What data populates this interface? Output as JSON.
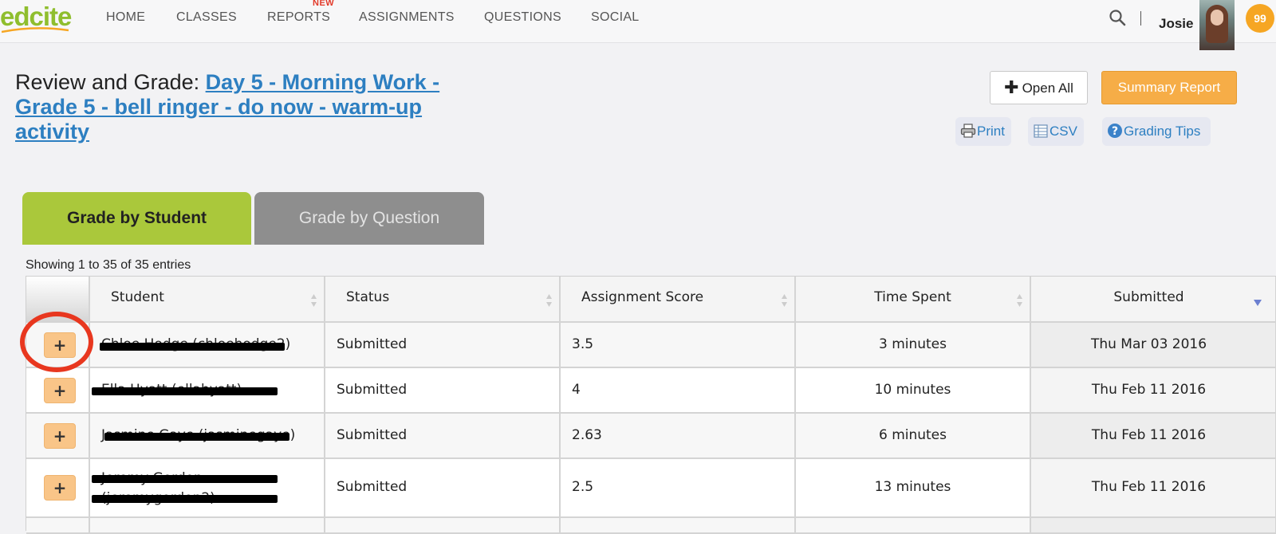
{
  "app": {
    "logo": "edcite"
  },
  "nav": {
    "items": [
      {
        "label": "HOME"
      },
      {
        "label": "CLASSES"
      },
      {
        "label": "REPORTS",
        "badge": "NEW"
      },
      {
        "label": "ASSIGNMENTS"
      },
      {
        "label": "QUESTIONS"
      },
      {
        "label": "SOCIAL"
      }
    ],
    "search_icon": "search-icon"
  },
  "user": {
    "name": "Josie",
    "points": "99"
  },
  "header": {
    "title_prefix": "Review and Grade: ",
    "title_link": "Day 5 - Morning Work - Grade 5 - bell ringer - do now - warm-up activity"
  },
  "actions": {
    "open_all": "Open All",
    "summary_report": "Summary Report",
    "print": "Print",
    "csv": "CSV",
    "grading_tips": "Grading Tips"
  },
  "tabs": [
    {
      "label": "Grade by Student",
      "active": true
    },
    {
      "label": "Grade by Question",
      "active": false
    }
  ],
  "table": {
    "info": "Showing 1 to 35 of 35 entries",
    "columns": [
      "",
      "Student",
      "Status",
      "Assignment Score",
      "Time Spent",
      "Submitted"
    ],
    "expand_label": "+",
    "rows": [
      {
        "student": "Chloe Hodge (chloehodge2)",
        "status": "Submitted",
        "score": "3.5",
        "time": "3 minutes",
        "submitted": "Thu Mar 03 2016"
      },
      {
        "student": "Ella Hyatt (ellahyatt)",
        "status": "Submitted",
        "score": "4",
        "time": "10 minutes",
        "submitted": "Thu Feb 11 2016"
      },
      {
        "student": "Jasmine Gaye (jasminegaye)",
        "status": "Submitted",
        "score": "2.63",
        "time": "6 minutes",
        "submitted": "Thu Feb 11 2016"
      },
      {
        "student": "Jeremy Gordon (jeremygordon2)",
        "status": "Submitted",
        "score": "2.5",
        "time": "13 minutes",
        "submitted": "Thu Feb 11 2016"
      }
    ]
  },
  "colors": {
    "brand_green": "#8fbe2e",
    "tab_active": "#aac83b",
    "tab_inactive": "#8e8e8e",
    "link_blue": "#2d7fc1",
    "summary_orange": "#f6ad47",
    "expand_button": "#f9c588",
    "annotation_red": "#e8371f"
  }
}
